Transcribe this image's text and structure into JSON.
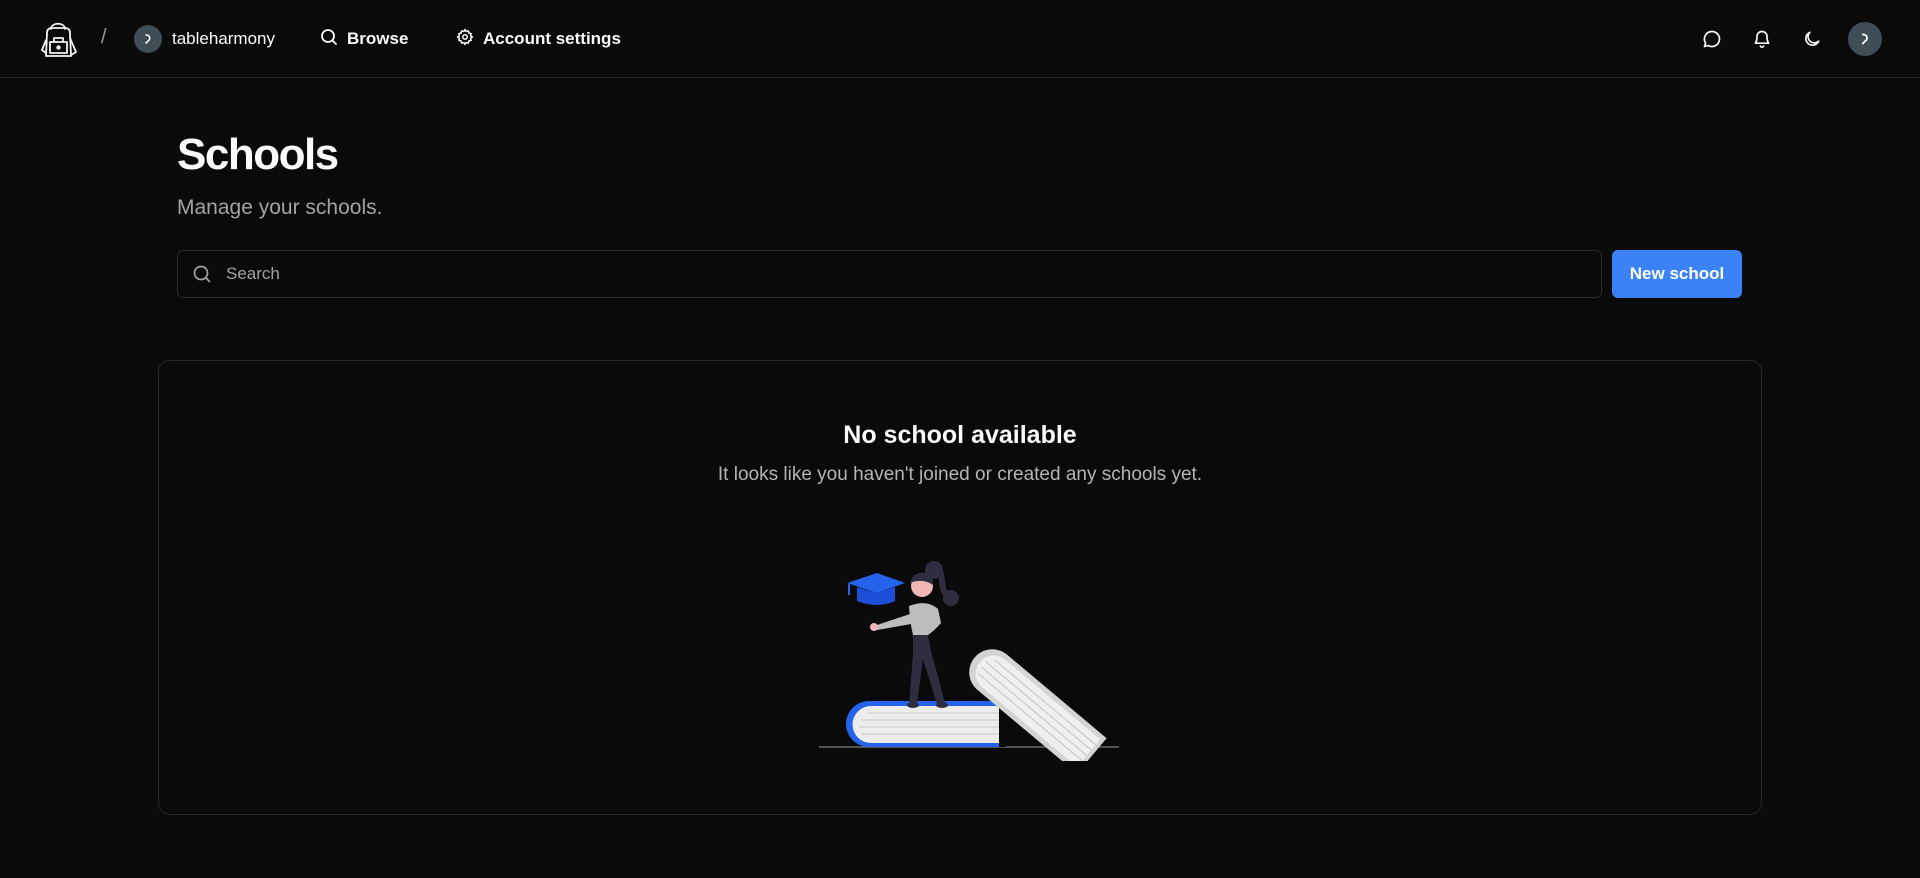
{
  "topbar": {
    "username": "tableharmony",
    "separator": "/",
    "nav": {
      "browse_label": "Browse",
      "settings_label": "Account settings"
    },
    "icons": [
      "backpack-logo-icon",
      "search-icon",
      "gear-icon",
      "chat-icon",
      "bell-icon",
      "moon-icon"
    ]
  },
  "header": {
    "title": "Schools",
    "subtitle": "Manage your schools."
  },
  "search": {
    "placeholder": "Search",
    "value": ""
  },
  "actions": {
    "new_school_label": "New school"
  },
  "empty_state": {
    "title": "No school available",
    "description": "It looks like you haven't joined or created any schools yet."
  },
  "colors": {
    "background": "#0a0a0a",
    "accent": "#3b82f6",
    "illustration_accent": "#2563eb",
    "border": "#262626",
    "avatar": "#3f4d57"
  }
}
